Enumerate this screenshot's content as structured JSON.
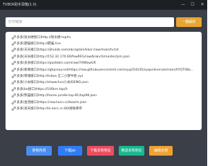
{
  "window": {
    "title": "TVBOX助手源箱(1.0)",
    "min_glyph": "—",
    "max_glyph": "☐",
    "close_glyph": "✕"
  },
  "search": {
    "placeholder": "打开链接",
    "button_label": "一键解析"
  },
  "list": {
    "prefix": "多多",
    "items": [
      "[饭太硬接口]http://饭太硬.top/tv",
      "[肥猫接口]http://肥猫.live",
      "[天天接口]https://jihulab.com/okcaptain/kko/-/raw/main/tv.txt",
      "[天乐接口]http://152.32.170.60/fewRFG/raw/branch/master/jsm.json",
      "[多多接口]https://pastebin.com/raw/7ANfawGR",
      "[菲菲接口]https://ghproxy.net/https://raw.githubusercontent.com/xyq254245/xyqonlinerule/main/XYQTVBo…",
      "[荷城接口]http://tvbox.王二小放牛娃.xyz",
      "[小米接口]http://xhww.fun/小米/DEMO.json",
      "[bo接口]https://100km.top/0",
      "[熊猫接口]http://home.jundie.top:81/top98.json",
      "[金羽接口]https://raw.liucn.cc/box/m.json",
      "[高天接口]http://lo.ezcc.cc:80/接收库存"
    ]
  },
  "actions": [
    {
      "label": "复制内容",
      "color": "#4a8df0"
    },
    {
      "label": "下载Jar",
      "color": "#2f7df6"
    },
    {
      "label": "下载本地地址",
      "color": "#ec4d5f"
    },
    {
      "label": "推送本地地址",
      "color": "#19b890"
    },
    {
      "label": "编辑全部",
      "color": "#f0a230"
    }
  ]
}
